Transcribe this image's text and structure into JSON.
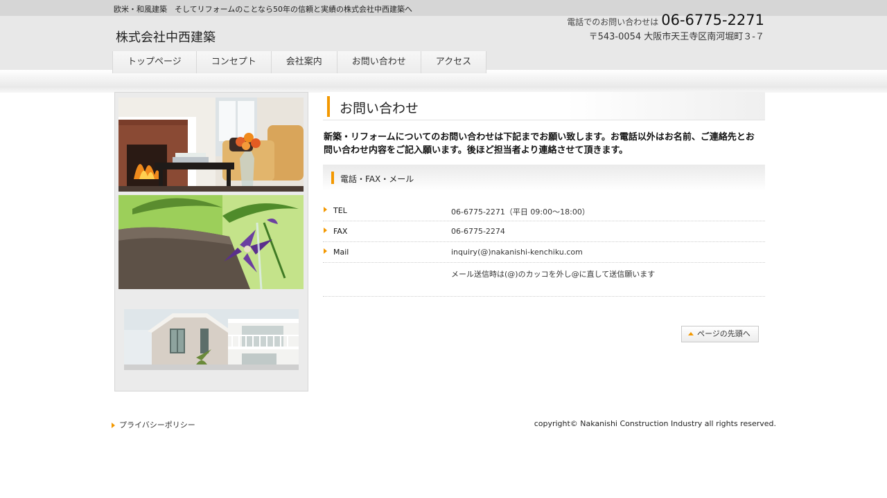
{
  "header": {
    "tagline": "欧米・和風建築　そしてリフォームのことなら50年の信頼と実績の株式会社中西建築へ",
    "logo": "株式会社中西建築",
    "phone_lead": "電話でのお問い合わせは",
    "phone_number": "06-6775-2271",
    "address": "〒543-0054 大阪市天王寺区南河堀町３-７"
  },
  "nav": {
    "items": [
      {
        "label": "トップページ"
      },
      {
        "label": "コンセプト"
      },
      {
        "label": "会社案内"
      },
      {
        "label": "お問い合わせ"
      },
      {
        "label": "アクセス"
      }
    ]
  },
  "main": {
    "title": "お問い合わせ",
    "lead": "新築・リフォームについてのお問い合わせは下記までお願い致します。お電話以外はお名前、ご連絡先とお問い合わせ内容をご記入願います。後ほど担当者より連絡させて頂きます。",
    "section_title": "電話・FAX・メール",
    "rows": [
      {
        "label": "TEL",
        "value": "06-6775-2271（平日 09:00～18:00）"
      },
      {
        "label": "FAX",
        "value": "06-6775-2274"
      },
      {
        "label": "Mail",
        "value": "inquiry(@)nakanishi-kenchiku.com"
      },
      {
        "label": "",
        "value": "メール送信時は(@)のカッコを外し@に直して送信願います"
      }
    ],
    "page_top": "ページの先頭へ"
  },
  "footer": {
    "privacy": "プライバシーポリシー",
    "copyright": "copyright© Nakanishi Construction Industry all rights reserved."
  },
  "colors": {
    "accent": "#f39800",
    "header_bg": "#e8e8e8",
    "topbar_bg": "#d6d6d6"
  }
}
